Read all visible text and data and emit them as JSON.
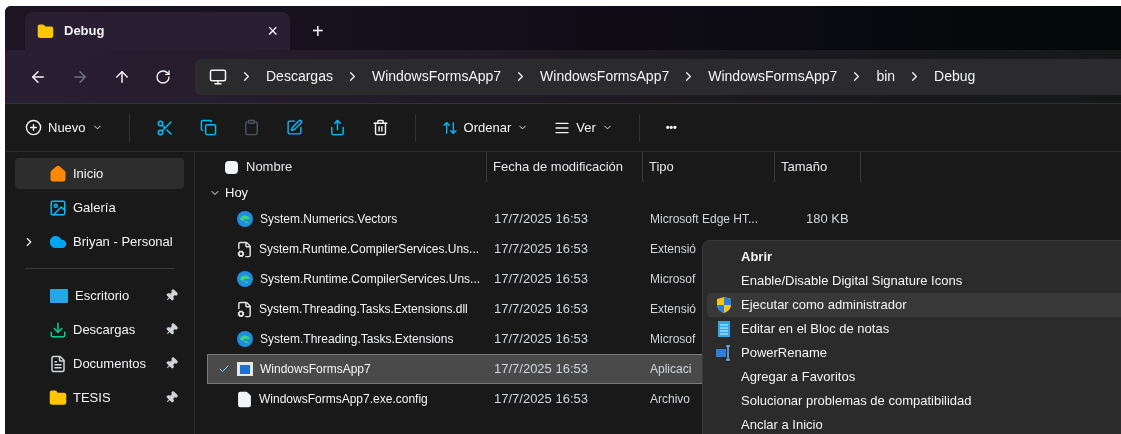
{
  "tab": {
    "title": "Debug",
    "close": "×",
    "new": "+"
  },
  "breadcrumb": [
    "Descargas",
    "WindowsFormsApp7",
    "WindowsFormsApp7",
    "WindowsFormsApp7",
    "bin",
    "Debug"
  ],
  "toolbar": {
    "new": "Nuevo",
    "sort": "Ordenar",
    "view": "Ver",
    "more": "•••"
  },
  "sidebar": {
    "items": [
      {
        "label": "Inicio",
        "kind": "home",
        "selected": true,
        "pinned": false,
        "expandable": false
      },
      {
        "label": "Galería",
        "kind": "gallery",
        "selected": false,
        "pinned": false,
        "expandable": false
      },
      {
        "label": "Briyan - Personal",
        "kind": "cloud",
        "selected": false,
        "pinned": false,
        "expandable": true
      },
      {
        "label": "Escritorio",
        "kind": "desktop",
        "selected": false,
        "pinned": true,
        "expandable": false,
        "divider_before": true
      },
      {
        "label": "Descargas",
        "kind": "download",
        "selected": false,
        "pinned": true,
        "expandable": false
      },
      {
        "label": "Documentos",
        "kind": "documents",
        "selected": false,
        "pinned": true,
        "expandable": false
      },
      {
        "label": "TESIS",
        "kind": "folder",
        "selected": false,
        "pinned": true,
        "expandable": false
      }
    ]
  },
  "table": {
    "columns": [
      "Nombre",
      "Fecha de modificación",
      "Tipo",
      "Tamaño"
    ],
    "select_all_checked": false,
    "group": "Hoy",
    "rows": [
      {
        "name": "System.Numerics.Vectors",
        "kind": "edge",
        "date": "17/7/2025 16:53",
        "type": "Microsoft Edge HT...",
        "size": "180 KB",
        "selected": false
      },
      {
        "name": "System.Runtime.CompilerServices.Uns...",
        "kind": "dll",
        "date": "17/7/2025 16:53",
        "type": "Extensió",
        "selected": false
      },
      {
        "name": "System.Runtime.CompilerServices.Uns...",
        "kind": "edge",
        "date": "17/7/2025 16:53",
        "type": "Microsof",
        "selected": false
      },
      {
        "name": "System.Threading.Tasks.Extensions.dll",
        "kind": "dll",
        "date": "17/7/2025 16:53",
        "type": "Extensió",
        "selected": false
      },
      {
        "name": "System.Threading.Tasks.Extensions",
        "kind": "edge",
        "date": "17/7/2025 16:53",
        "type": "Microsof",
        "selected": false
      },
      {
        "name": "WindowsFormsApp7",
        "kind": "app",
        "date": "17/7/2025 16:53",
        "type": "Aplicaci",
        "selected": true
      },
      {
        "name": "WindowsFormsApp7.exe.config",
        "kind": "file",
        "date": "17/7/2025 16:53",
        "type": "Archivo",
        "selected": false
      }
    ]
  },
  "context_menu": {
    "items": [
      {
        "label": "Abrir",
        "kind": "default",
        "selected": false
      },
      {
        "label": "Enable/Disable Digital Signature Icons",
        "kind": "none",
        "selected": false
      },
      {
        "label": "Ejecutar como administrador",
        "kind": "shield",
        "selected": true
      },
      {
        "label": "Editar en el Bloc de notas",
        "kind": "notepad",
        "selected": false
      },
      {
        "label": "PowerRename",
        "kind": "rename",
        "selected": false
      },
      {
        "label": "Agregar a Favoritos",
        "kind": "none",
        "selected": false
      },
      {
        "label": "Solucionar problemas de compatibilidad",
        "kind": "none",
        "selected": false
      },
      {
        "label": "Anclar a Inicio",
        "kind": "none",
        "selected": false
      }
    ]
  }
}
